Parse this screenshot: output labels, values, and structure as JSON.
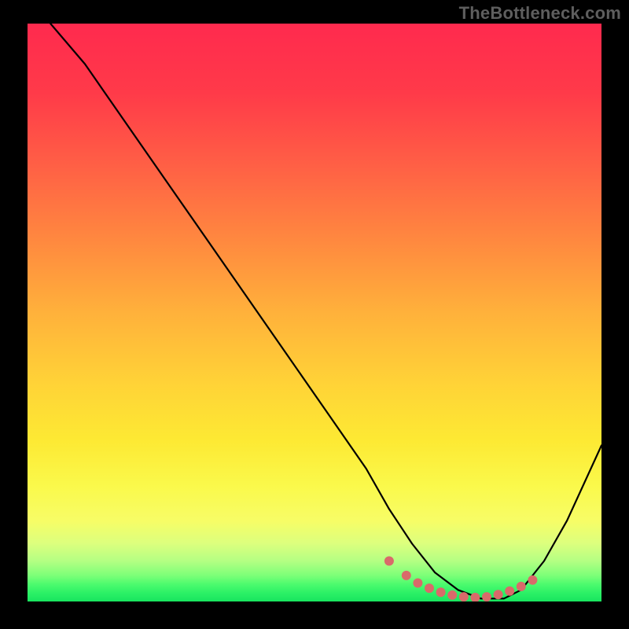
{
  "watermark": "TheBottleneck.com",
  "chart_data": {
    "type": "line",
    "title": "",
    "xlabel": "",
    "ylabel": "",
    "xlim": [
      0,
      100
    ],
    "ylim": [
      0,
      100
    ],
    "grid": false,
    "legend": false,
    "series": [
      {
        "name": "bottleneck-curve",
        "x": [
          4,
          10,
          17,
          24,
          31,
          38,
          45,
          52,
          59,
          63,
          67,
          71,
          75,
          79,
          83,
          86,
          90,
          94,
          100
        ],
        "values": [
          100,
          93,
          83,
          73,
          63,
          53,
          43,
          33,
          23,
          16,
          10,
          5,
          2,
          0.5,
          0.5,
          2,
          7,
          14,
          27
        ]
      }
    ],
    "markers": {
      "name": "optimal-range",
      "x": [
        63,
        66,
        68,
        70,
        72,
        74,
        76,
        78,
        80,
        82,
        84,
        86,
        88
      ],
      "values": [
        7,
        4.5,
        3.2,
        2.3,
        1.6,
        1.1,
        0.8,
        0.7,
        0.8,
        1.2,
        1.8,
        2.6,
        3.7
      ]
    },
    "gradient_stops": [
      {
        "pos": 0,
        "color": "#ff2a4e"
      },
      {
        "pos": 25,
        "color": "#ff6145"
      },
      {
        "pos": 50,
        "color": "#ffb13b"
      },
      {
        "pos": 72,
        "color": "#fde933"
      },
      {
        "pos": 90,
        "color": "#dcff7e"
      },
      {
        "pos": 100,
        "color": "#18e45f"
      }
    ]
  }
}
